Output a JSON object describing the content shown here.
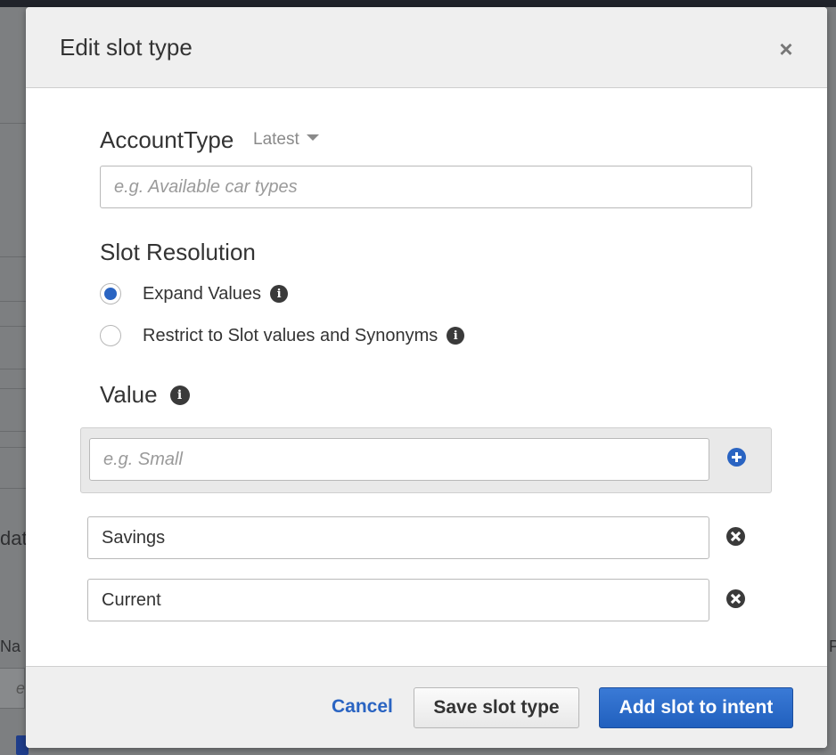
{
  "background": {
    "fragment_left_1": "dat",
    "fragment_left_2": "Na",
    "fragment_left_3": "e",
    "fragment_right": "P"
  },
  "modal": {
    "title": "Edit slot type",
    "close_icon": "close-icon",
    "slot_type_name": "AccountType",
    "version_label": "Latest",
    "description_input": {
      "value": "",
      "placeholder": "e.g. Available car types"
    },
    "slot_resolution": {
      "title": "Slot Resolution",
      "options": [
        {
          "label": "Expand Values",
          "selected": true
        },
        {
          "label": "Restrict to Slot values and Synonyms",
          "selected": false
        }
      ]
    },
    "value_section": {
      "title": "Value",
      "new_value_input": {
        "value": "",
        "placeholder": "e.g. Small"
      },
      "values": [
        "Savings",
        "Current"
      ]
    },
    "footer": {
      "cancel_label": "Cancel",
      "save_label": "Save slot type",
      "add_label": "Add slot to intent"
    }
  },
  "colors": {
    "accent": "#2a64c2",
    "primary_button": "#2a68c8",
    "overlay": "#7d7f81"
  }
}
